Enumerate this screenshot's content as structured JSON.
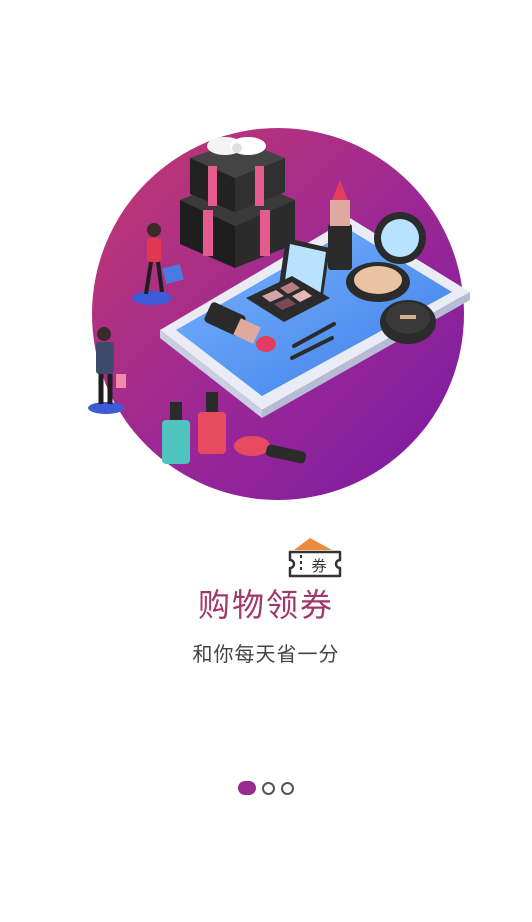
{
  "onboarding": {
    "title": "购物领券",
    "subtitle": "和你每天省一分",
    "coupon_icon_text": "券",
    "title_color": "#a0386a",
    "page_indicator": {
      "total": 3,
      "current": 1,
      "active_color": "#9b2a8e",
      "inactive_color": "#555555"
    }
  },
  "hero": {
    "description": "shopping-cosmetics-illustration",
    "gradient_colors": [
      "#a9356b",
      "#7a1aa3"
    ]
  }
}
